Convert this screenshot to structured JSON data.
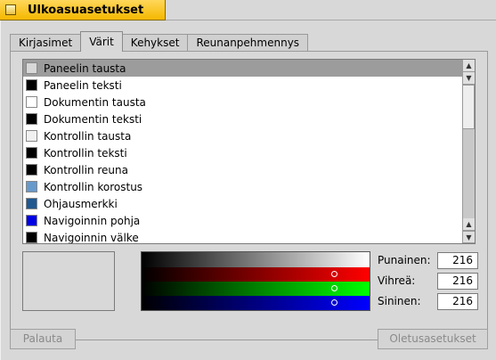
{
  "window": {
    "title": "Ulkoasuasetukset"
  },
  "tabs": [
    {
      "label": "Kirjasimet"
    },
    {
      "label": "Värit"
    },
    {
      "label": "Kehykset"
    },
    {
      "label": "Reunanpehmennys"
    }
  ],
  "color_list": {
    "items": [
      {
        "label": "Paneelin tausta",
        "color": "#d8d8d8"
      },
      {
        "label": "Paneelin teksti",
        "color": "#000000"
      },
      {
        "label": "Dokumentin tausta",
        "color": "#ffffff"
      },
      {
        "label": "Dokumentin teksti",
        "color": "#000000"
      },
      {
        "label": "Kontrollin tausta",
        "color": "#f0f0f0"
      },
      {
        "label": "Kontrollin teksti",
        "color": "#000000"
      },
      {
        "label": "Kontrollin reuna",
        "color": "#000000"
      },
      {
        "label": "Kontrollin korostus",
        "color": "#6699cc"
      },
      {
        "label": "Ohjausmerkki",
        "color": "#205890"
      },
      {
        "label": "Navigoinnin pohja",
        "color": "#0000e5"
      },
      {
        "label": "Navigoinnin välke",
        "color": "#000000"
      }
    ],
    "selected_index": 0
  },
  "color_picker": {
    "red_label": "Punainen:",
    "green_label": "Vihreä:",
    "blue_label": "Sininen:",
    "red": "216",
    "green": "216",
    "blue": "216"
  },
  "buttons": {
    "revert_label": "Palauta",
    "defaults_label": "Oletusasetukset"
  }
}
